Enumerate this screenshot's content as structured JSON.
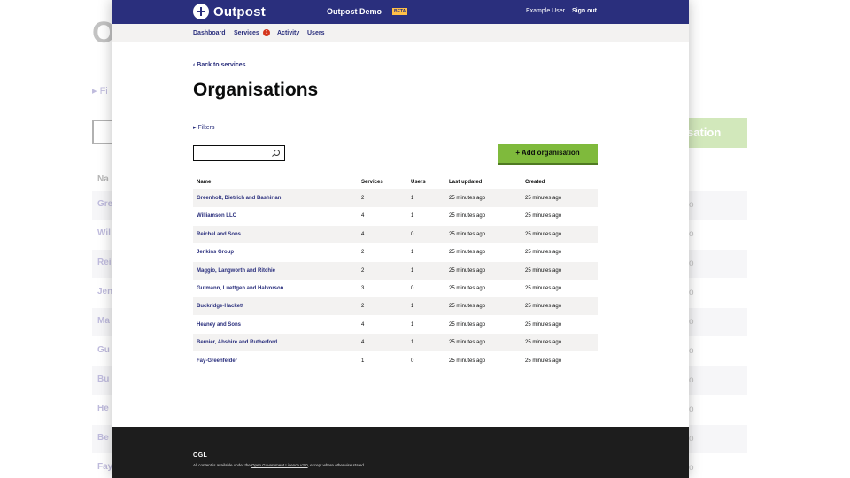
{
  "background": {
    "title": "O",
    "filters": "▸ Fi",
    "add_label": "sation",
    "header_name": "Na",
    "rows": [
      {
        "name": "Gre",
        "date": "o"
      },
      {
        "name": "Wil",
        "date": "o"
      },
      {
        "name": "Rei",
        "date": "o"
      },
      {
        "name": "Jen",
        "date": "o"
      },
      {
        "name": "Ma",
        "date": "o"
      },
      {
        "name": "Gu",
        "date": "o"
      },
      {
        "name": "Bu",
        "date": "o"
      },
      {
        "name": "He",
        "date": "o"
      },
      {
        "name": "Be",
        "date": "o"
      },
      {
        "name": "Fay",
        "date": "o"
      }
    ]
  },
  "header": {
    "logo_text": "Outpost",
    "service_name": "Outpost Demo",
    "beta": "BETA",
    "user": "Example User",
    "sign_out": "Sign out"
  },
  "nav": {
    "dashboard": "Dashboard",
    "services": "Services",
    "services_badge": "1",
    "activity": "Activity",
    "users": "Users"
  },
  "page": {
    "back_link": "‹  Back to services",
    "title": "Organisations",
    "filters": "▸  Filters",
    "search_placeholder": "",
    "add_button": "+  Add organisation"
  },
  "table": {
    "headers": {
      "name": "Name",
      "services": "Services",
      "users": "Users",
      "updated": "Last updated",
      "created": "Created"
    },
    "rows": [
      {
        "name": "Greenholt, Dietrich and Bashirian",
        "services": "2",
        "users": "1",
        "updated": "25 minutes ago",
        "created": "25 minutes ago"
      },
      {
        "name": "Williamson LLC",
        "services": "4",
        "users": "1",
        "updated": "25 minutes ago",
        "created": "25 minutes ago"
      },
      {
        "name": "Reichel and Sons",
        "services": "4",
        "users": "0",
        "updated": "25 minutes ago",
        "created": "25 minutes ago"
      },
      {
        "name": "Jenkins Group",
        "services": "2",
        "users": "1",
        "updated": "25 minutes ago",
        "created": "25 minutes ago"
      },
      {
        "name": "Maggio, Langworth and Ritchie",
        "services": "2",
        "users": "1",
        "updated": "25 minutes ago",
        "created": "25 minutes ago"
      },
      {
        "name": "Gutmann, Luettgen and Halvorson",
        "services": "3",
        "users": "0",
        "updated": "25 minutes ago",
        "created": "25 minutes ago"
      },
      {
        "name": "Buckridge-Hackett",
        "services": "2",
        "users": "1",
        "updated": "25 minutes ago",
        "created": "25 minutes ago"
      },
      {
        "name": "Heaney and Sons",
        "services": "4",
        "users": "1",
        "updated": "25 minutes ago",
        "created": "25 minutes ago"
      },
      {
        "name": "Bernier, Abshire and Rutherford",
        "services": "4",
        "users": "1",
        "updated": "25 minutes ago",
        "created": "25 minutes ago"
      },
      {
        "name": "Fay-Greenfelder",
        "services": "1",
        "users": "0",
        "updated": "25 minutes ago",
        "created": "25 minutes ago"
      }
    ]
  },
  "footer": {
    "logo": "OGL",
    "licence_prefix": "All content is available under the ",
    "licence_link": "Open Government Licence v3.0",
    "licence_suffix": ", except where otherwise stated"
  }
}
